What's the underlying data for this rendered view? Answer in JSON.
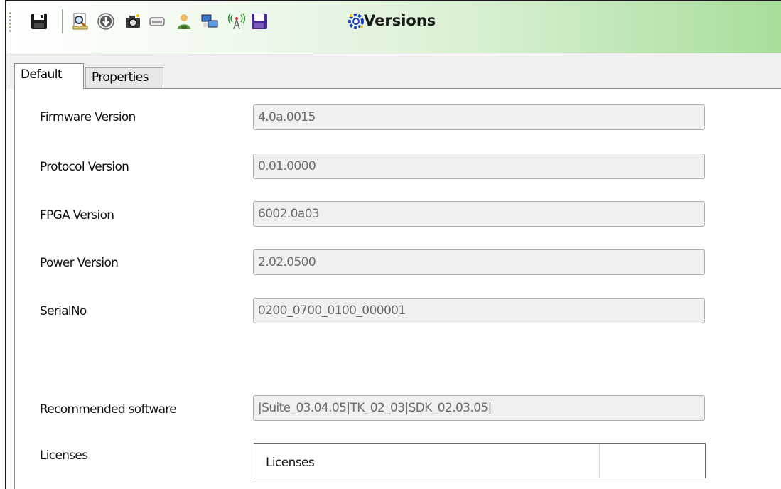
{
  "toolbar": {
    "title": "Versions",
    "buttons": [
      {
        "icon": "floppy-disk-icon"
      },
      {
        "icon": "print-preview-icon"
      },
      {
        "icon": "download-arrow-icon"
      },
      {
        "icon": "camera-icon"
      },
      {
        "icon": "card-icon"
      },
      {
        "icon": "user-icon"
      },
      {
        "icon": "network-computers-icon"
      },
      {
        "icon": "wireless-antenna-icon"
      },
      {
        "icon": "save-purple-icon"
      },
      {
        "icon": "settings-gear-icon"
      }
    ]
  },
  "tabs": {
    "default": "Default",
    "properties": "Properties"
  },
  "fields": {
    "firmware": {
      "label": "Firmware Version",
      "value": "4.0a.0015"
    },
    "protocol": {
      "label": "Protocol Version",
      "value": "0.01.0000"
    },
    "fpga": {
      "label": "FPGA Version",
      "value": "6002.0a03"
    },
    "power": {
      "label": "Power Version",
      "value": "2.02.0500"
    },
    "serial": {
      "label": "SerialNo",
      "value": "0200_0700_0100_000001"
    },
    "recommended": {
      "label": "Recommended software",
      "value": "|Suite_03.04.05|TK_02_03|SDK_02.03.05|"
    }
  },
  "licenses": {
    "label": "Licenses",
    "column_header": "Licenses"
  }
}
